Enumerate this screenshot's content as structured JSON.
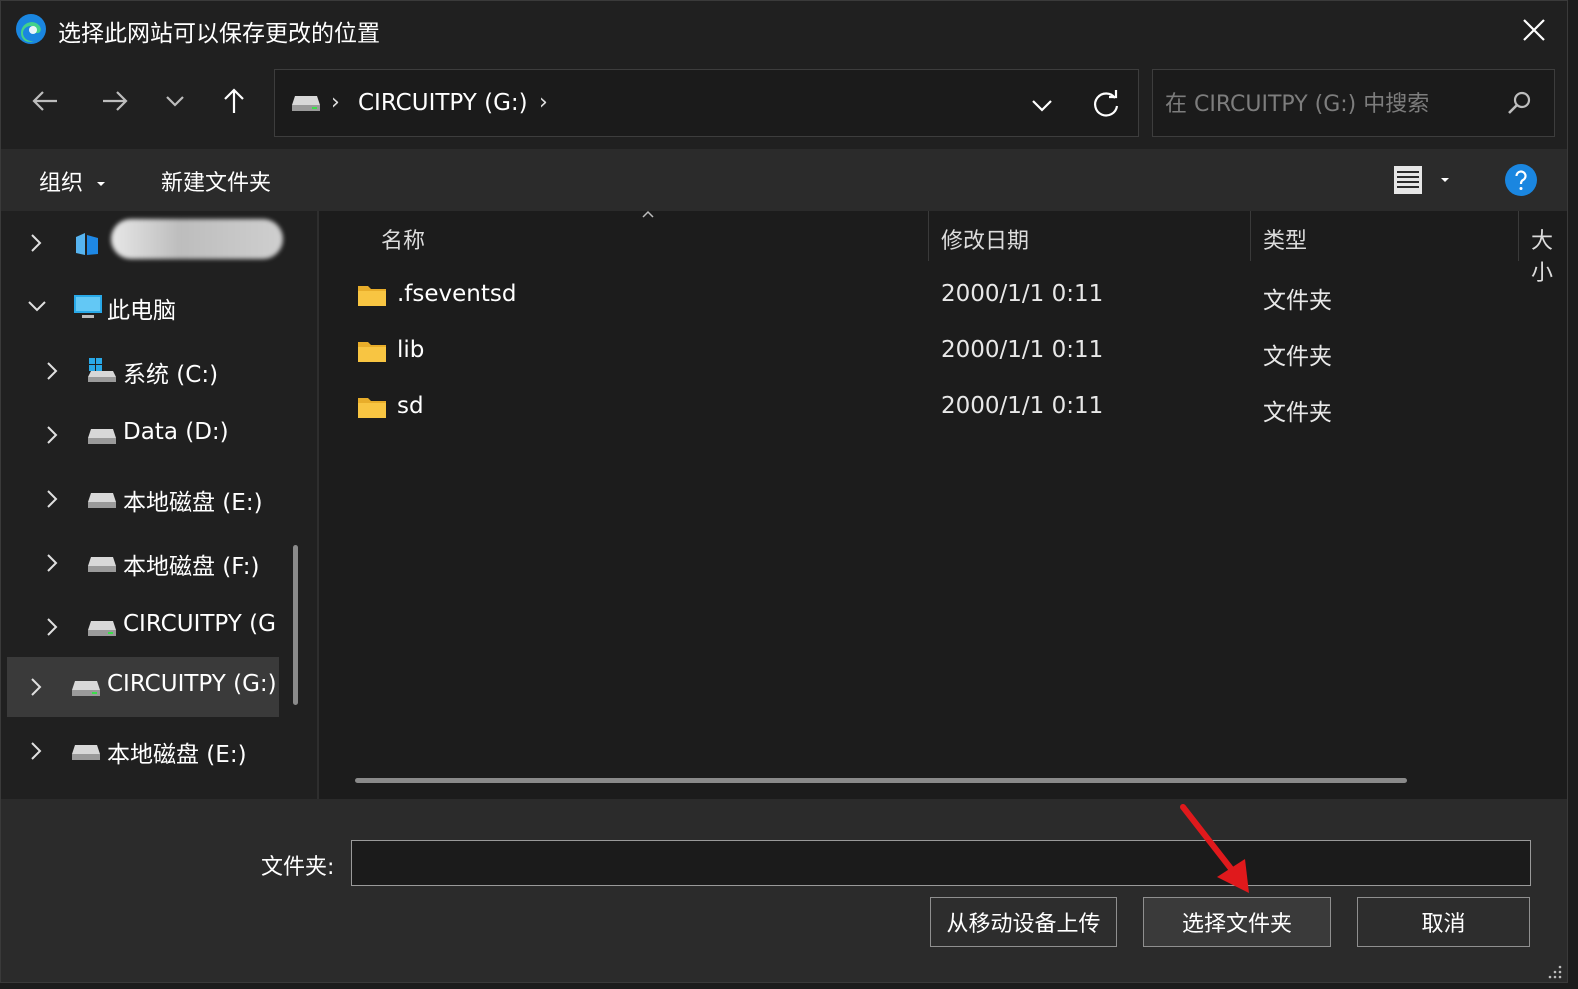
{
  "window": {
    "title": "选择此网站可以保存更改的位置"
  },
  "address_bar": {
    "breadcrumb": [
      "CIRCUITPY (G:)"
    ],
    "separator": "›"
  },
  "search": {
    "placeholder": "在 CIRCUITPY (G:) 中搜索"
  },
  "commands": {
    "organize": "组织",
    "new_folder": "新建文件夹"
  },
  "tree": {
    "items": [
      {
        "label": "",
        "icon": "cloud-drive-icon",
        "expanded": false,
        "redacted": true
      },
      {
        "label": "此电脑",
        "icon": "computer-icon",
        "expanded": true
      },
      {
        "label": "系统 (C:)",
        "icon": "system-drive-icon",
        "expanded": false
      },
      {
        "label": "Data (D:)",
        "icon": "drive-icon",
        "expanded": false
      },
      {
        "label": "本地磁盘 (E:)",
        "icon": "drive-icon",
        "expanded": false
      },
      {
        "label": "本地磁盘 (F:)",
        "icon": "drive-icon",
        "expanded": false
      },
      {
        "label": "CIRCUITPY (G",
        "icon": "drive-icon",
        "expanded": false
      },
      {
        "label": "CIRCUITPY (G:)",
        "icon": "drive-icon",
        "expanded": false,
        "selected": true
      },
      {
        "label": "本地磁盘 (E:)",
        "icon": "drive-icon",
        "expanded": false
      }
    ]
  },
  "file_list": {
    "columns": [
      "名称",
      "修改日期",
      "类型",
      "大小"
    ],
    "rows": [
      {
        "name": ".fseventsd",
        "modified": "2000/1/1 0:11",
        "type": "文件夹"
      },
      {
        "name": "lib",
        "modified": "2000/1/1 0:11",
        "type": "文件夹"
      },
      {
        "name": "sd",
        "modified": "2000/1/1 0:11",
        "type": "文件夹"
      }
    ]
  },
  "footer": {
    "folder_label": "文件夹:",
    "folder_value": "",
    "upload_button": "从移动设备上传",
    "select_button": "选择文件夹",
    "cancel_button": "取消"
  },
  "colors": {
    "background": "#202020",
    "folder": "#f8c542",
    "accent": "#1a86e0",
    "annotation": "#e0191c"
  }
}
